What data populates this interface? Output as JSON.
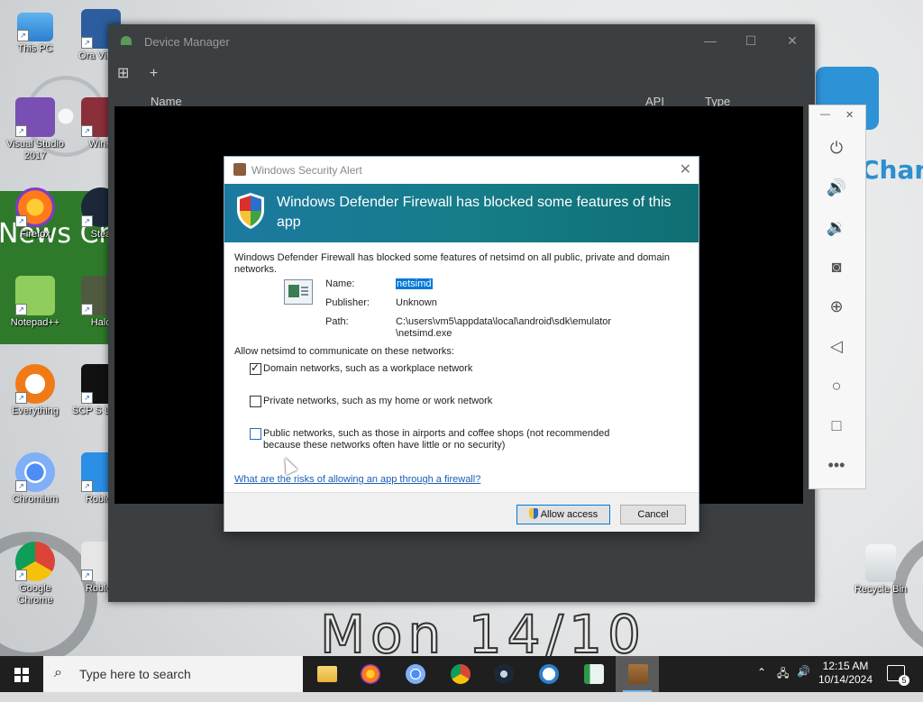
{
  "desktop": {
    "wallpaper_text": {
      "news": "News Ch",
      "channel": "Channe",
      "date": "Mon 14/10"
    },
    "icons": [
      {
        "label": "This PC"
      },
      {
        "label": "Ora Virtua"
      },
      {
        "label": "Visual Studio 2017"
      },
      {
        "label": "WinR"
      },
      {
        "label": "Firefox"
      },
      {
        "label": "Stea"
      },
      {
        "label": "Notepad++"
      },
      {
        "label": "Halo"
      },
      {
        "label": "Everything"
      },
      {
        "label": "SCP S Labor"
      },
      {
        "label": "Chromium"
      },
      {
        "label": "Roblox"
      },
      {
        "label": "Google Chrome"
      },
      {
        "label": "Roblox"
      },
      {
        "label": "Recycle Bin"
      }
    ]
  },
  "device_manager": {
    "title": "Device Manager",
    "columns": {
      "name": "Name",
      "api": "API",
      "type": "Type"
    }
  },
  "dialog": {
    "title": "Windows Security Alert",
    "banner": "Windows Defender Firewall has blocked some features of this app",
    "description": "Windows Defender Firewall has blocked some features of netsimd on all public, private and domain networks.",
    "name_label": "Name:",
    "name_value": "netsimd",
    "publisher_label": "Publisher:",
    "publisher_value": "Unknown",
    "path_label": "Path:",
    "path_value_line1": "C:\\users\\vm5\\appdata\\local\\android\\sdk\\emulator",
    "path_value_line2": "\\netsimd.exe",
    "allow_prompt": "Allow netsimd to communicate on these networks:",
    "options": [
      {
        "label": "Domain networks, such as a workplace network",
        "checked": true
      },
      {
        "label": "Private networks, such as my home or work network",
        "checked": false
      },
      {
        "label_line1": "Public networks, such as those in airports and coffee shops (not recommended",
        "label_line2": "because these networks often have little or no security)",
        "checked": false
      }
    ],
    "risk_link": "What are the risks of allowing an app through a firewall?",
    "allow_button": "Allow access",
    "cancel_button": "Cancel"
  },
  "taskbar": {
    "search_placeholder": "Type here to search",
    "time": "12:15 AM",
    "date": "10/14/2024",
    "notification_count": "5",
    "apps": [
      "file-explorer",
      "firefox",
      "chromium",
      "chrome",
      "steam",
      "app-store",
      "notepad",
      "active-app"
    ]
  }
}
